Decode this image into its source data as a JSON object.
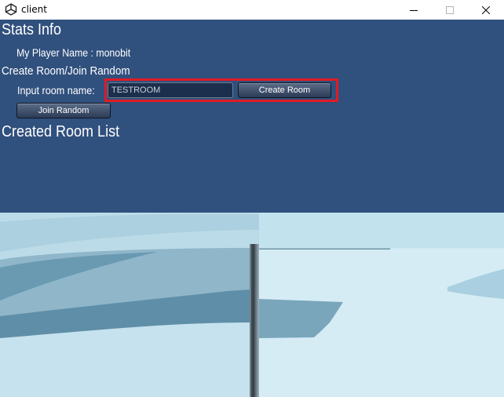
{
  "window": {
    "title": "client",
    "icon": "unity-icon",
    "controls": [
      "minimize-icon",
      "maximize-icon",
      "close-icon"
    ]
  },
  "ui": {
    "stats_heading": "Stats Info",
    "player_name_line": "My Player Name : monobit",
    "create_join_heading": "Create Room/Join Random",
    "input_label": "Input room name:",
    "room_name_input": {
      "value": "TESTROOM"
    },
    "create_room_button": "Create Room",
    "join_random_button": "Join Random",
    "room_list_heading": "Created Room List"
  },
  "colors": {
    "sky": "#30507d",
    "highlight": "#e01b24"
  }
}
